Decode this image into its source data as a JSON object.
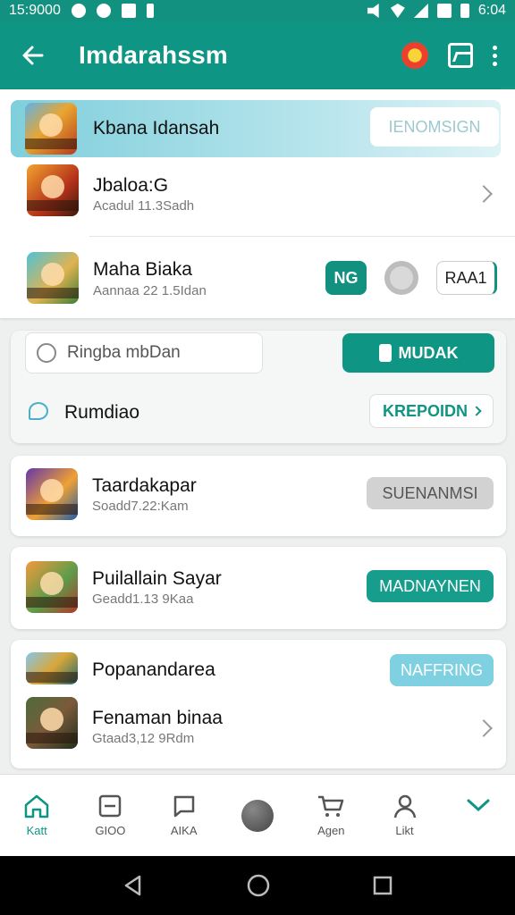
{
  "status_bar": {
    "time": "15:9000",
    "clock": "6:04"
  },
  "app_bar": {
    "title": "Imdarahssm"
  },
  "featured": {
    "title": "Kbana Idansah",
    "button": "IENOMSIGN"
  },
  "list1": [
    {
      "name": "Jbaloa:G",
      "sub": "Acadul 11.3Sadh"
    },
    {
      "name": "Maha Biaka",
      "sub": "Aannaa 22 1.5Idan",
      "btn1": "NG",
      "btn2": "RAA1"
    }
  ],
  "search": {
    "placeholder": "Ringba mbDan",
    "button": "MUDAK"
  },
  "rumdian": {
    "label": "Rumdiao",
    "button": "KREPOIDN"
  },
  "card2": {
    "name": "Taardakapar",
    "sub": "Soadd7.22:Kam",
    "button": "SUENANMSI"
  },
  "card3": {
    "name": "Puilallain Sayar",
    "sub": "Geadd1.13 9Kaa",
    "button": "MADNAYNEN"
  },
  "card4": [
    {
      "name": "Popanandarea",
      "button": "NAFFRING"
    },
    {
      "name": "Fenaman binaa",
      "sub": "Gtaad3,12 9Rdm"
    }
  ],
  "bottom_nav": [
    {
      "label": "Katt",
      "icon": "home-icon"
    },
    {
      "label": "GIOO",
      "icon": "card-icon"
    },
    {
      "label": "AIKA",
      "icon": "chat-icon"
    },
    {
      "label": "",
      "icon": "ball-icon"
    },
    {
      "label": "Agen",
      "icon": "cart-icon"
    },
    {
      "label": "Likt",
      "icon": "user-icon"
    },
    {
      "label": "",
      "icon": "chevron-down-icon"
    }
  ],
  "colors": {
    "primary": "#0f9583",
    "accent": "#129180",
    "light_accent": "#7fd0e0"
  }
}
